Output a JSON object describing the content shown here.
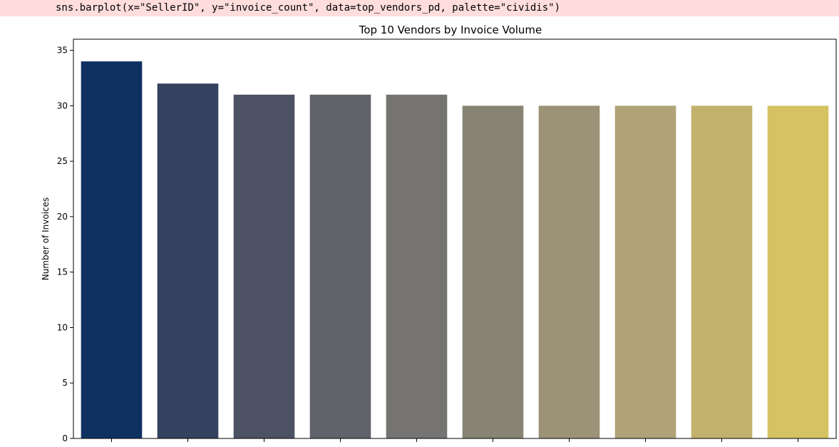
{
  "code_cell": {
    "line": "sns.barplot(x=\"SellerID\", y=\"invoice_count\", data=top_vendors_pd, palette=\"cividis\")"
  },
  "chart_data": {
    "type": "bar",
    "title": "Top 10 Vendors by Invoice Volume",
    "xlabel": "",
    "ylabel": "Number of Invoices",
    "ylim": [
      0,
      36
    ],
    "yticks": [
      0,
      5,
      10,
      15,
      20,
      25,
      30,
      35
    ],
    "categories": [
      "",
      "",
      "",
      "",
      "",
      "",
      "",
      "",
      "",
      ""
    ],
    "values": [
      34,
      32,
      31,
      31,
      31,
      30,
      30,
      30,
      30,
      30
    ],
    "colors": [
      "#0f3162",
      "#34425f",
      "#4c5264",
      "#61636b",
      "#757473",
      "#878375",
      "#9b9277",
      "#afa377",
      "#c2b26e",
      "#d5c363"
    ],
    "grid": false,
    "legend": "none"
  }
}
